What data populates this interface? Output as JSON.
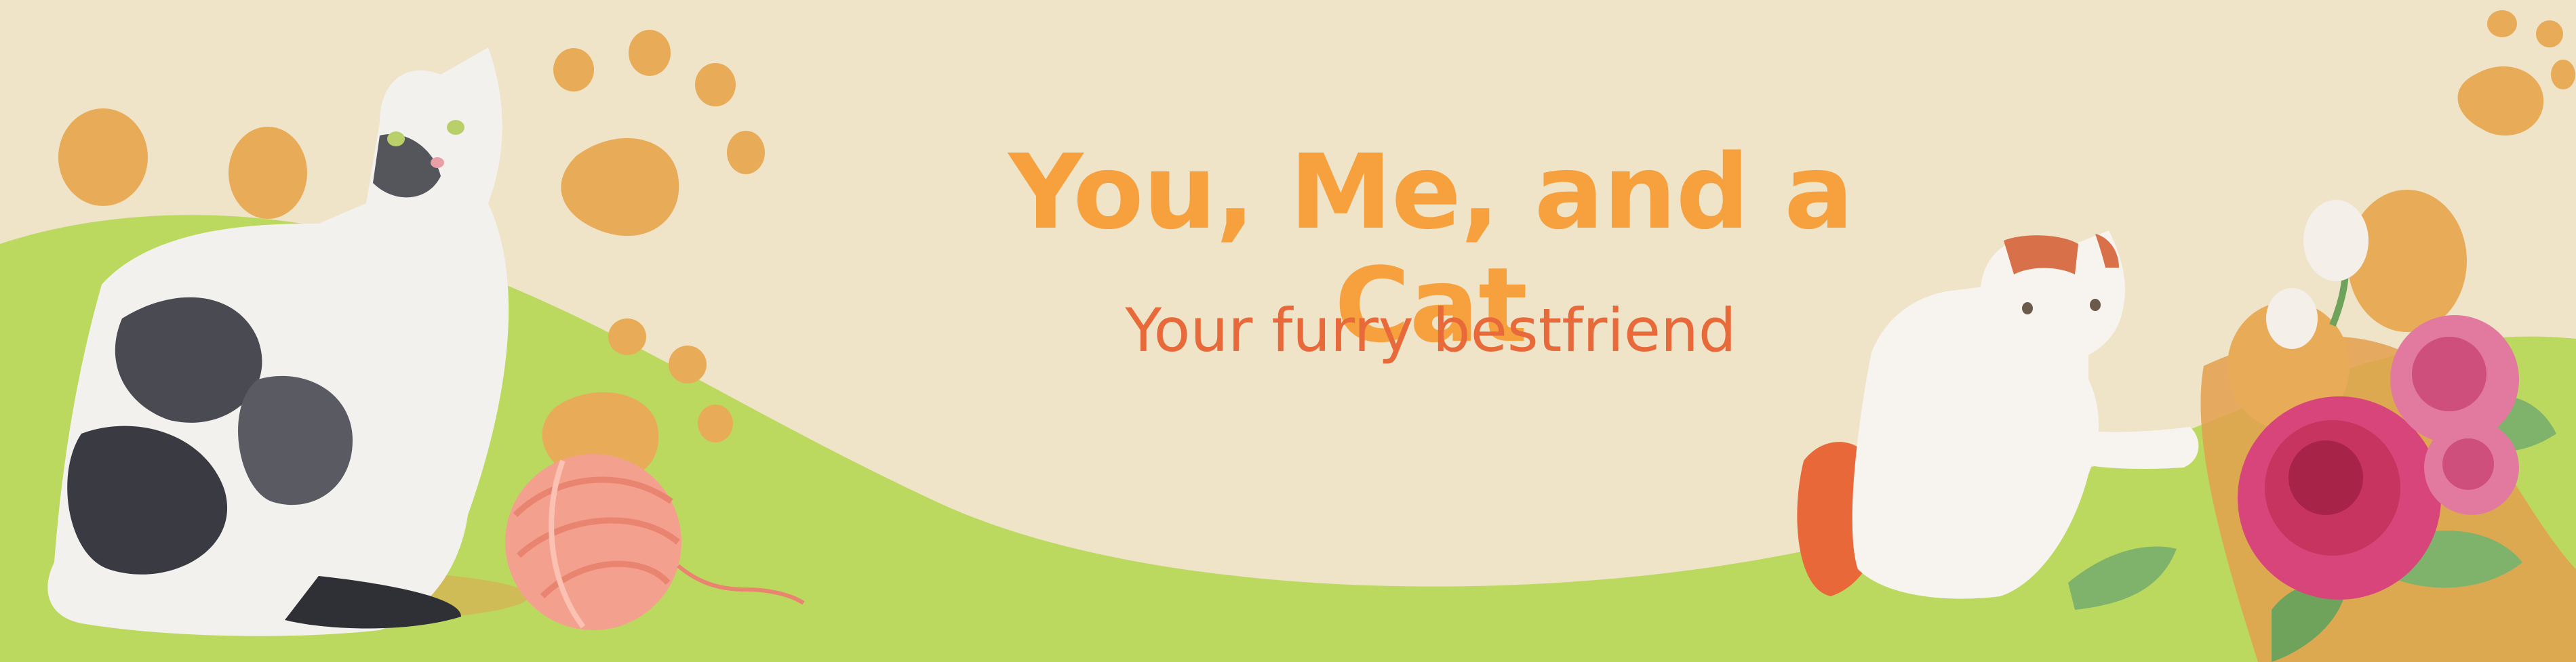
{
  "banner": {
    "title": "You, Me, and a Cat",
    "subtitle": "Your furry bestfriend"
  },
  "colors": {
    "background": "#efe3c8",
    "hill_green": "#bcd95f",
    "paw_orange": "#e8ac58",
    "title_orange": "#f6a13e",
    "subtitle_orange": "#e86a3a",
    "yarn_pink": "#f3a08e",
    "rose_pink": "#d8457a",
    "leaf_green": "#7fb26a"
  },
  "decorations": {
    "left_cat": "tabby-cat-illustration",
    "yarn": "yarn-ball-illustration",
    "right_cat": "white-cat-illustration",
    "flowers": "pink-rose-bouquet-illustration",
    "paws": "paw-print-icon"
  }
}
